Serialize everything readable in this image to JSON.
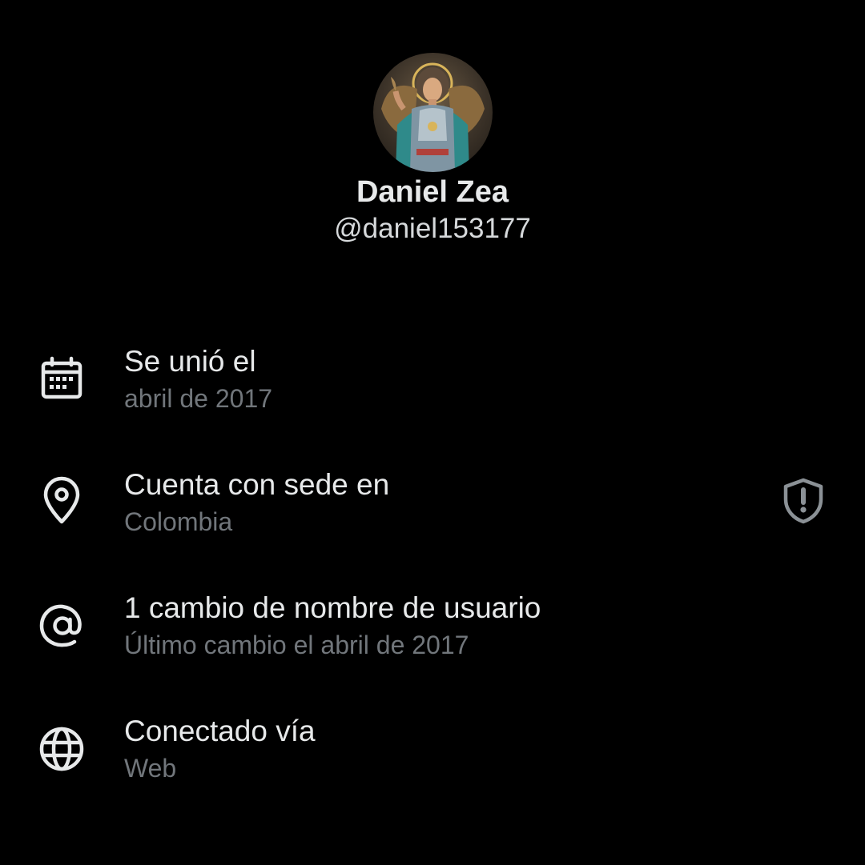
{
  "profile": {
    "display_name": "Daniel Zea",
    "handle": "@daniel153177",
    "avatar_icon": "avatar-image"
  },
  "about": {
    "items": [
      {
        "icon": "calendar-icon",
        "title": "Se unió el",
        "subtitle": "abril de 2017"
      },
      {
        "icon": "location-pin-icon",
        "title": "Cuenta con sede en",
        "subtitle": "Colombia",
        "right_icon": "shield-alert-icon"
      },
      {
        "icon": "at-sign-icon",
        "title": "1 cambio de nombre de usuario",
        "subtitle": "Último cambio el abril de 2017"
      },
      {
        "icon": "globe-icon",
        "title": "Conectado vía",
        "subtitle": "Web"
      }
    ]
  },
  "colors": {
    "background": "#000000",
    "primary_text": "#e7e9ea",
    "secondary_text": "#71767b",
    "icon": "#e7e9ea",
    "shield_icon": "#8b9196"
  }
}
